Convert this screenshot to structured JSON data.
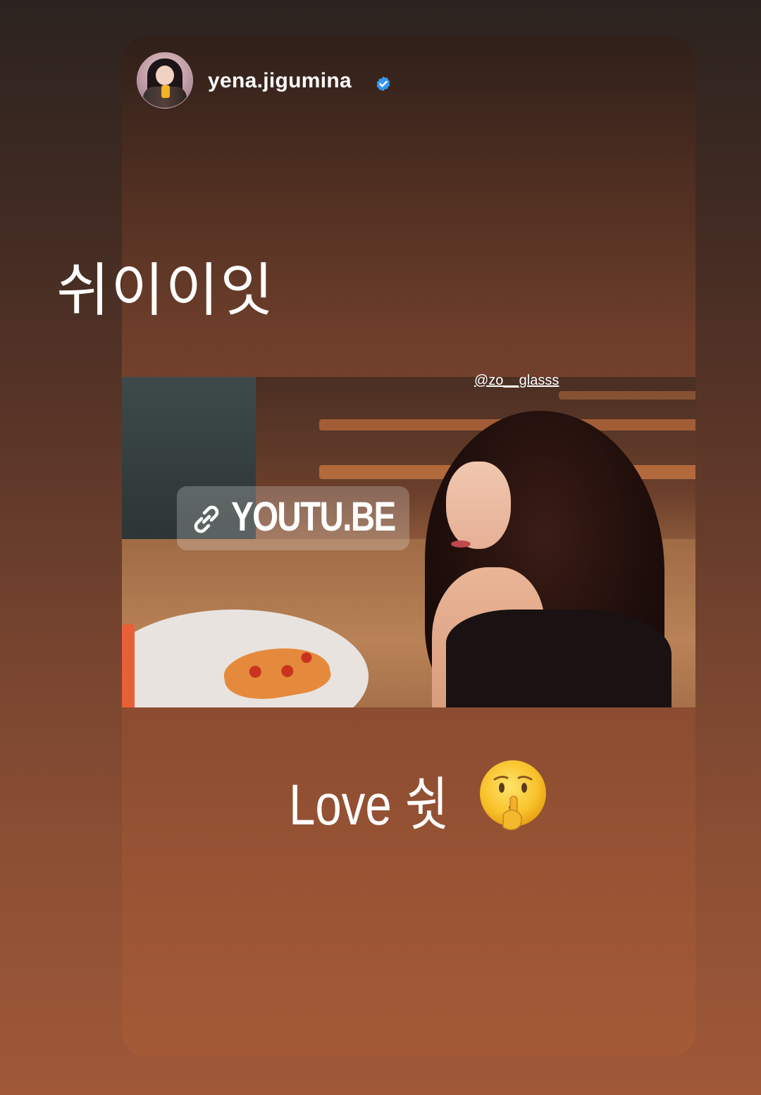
{
  "story": {
    "username": "yena.jigumina",
    "verified": true,
    "verified_color": "#3897f0",
    "avatar_icon": "profile-avatar",
    "caption_top": "쉬이이잇",
    "caption_bottom": "Love 쉿",
    "caption_bottom_emoji": "shushing-face-icon"
  },
  "photo": {
    "credit": "@zo__glasss"
  },
  "link_sticker": {
    "icon": "link-icon",
    "label": "YOUTU.BE"
  },
  "colors": {
    "background_top": "#2c2320",
    "background_bottom": "#a05838",
    "text": "#ffffff"
  }
}
